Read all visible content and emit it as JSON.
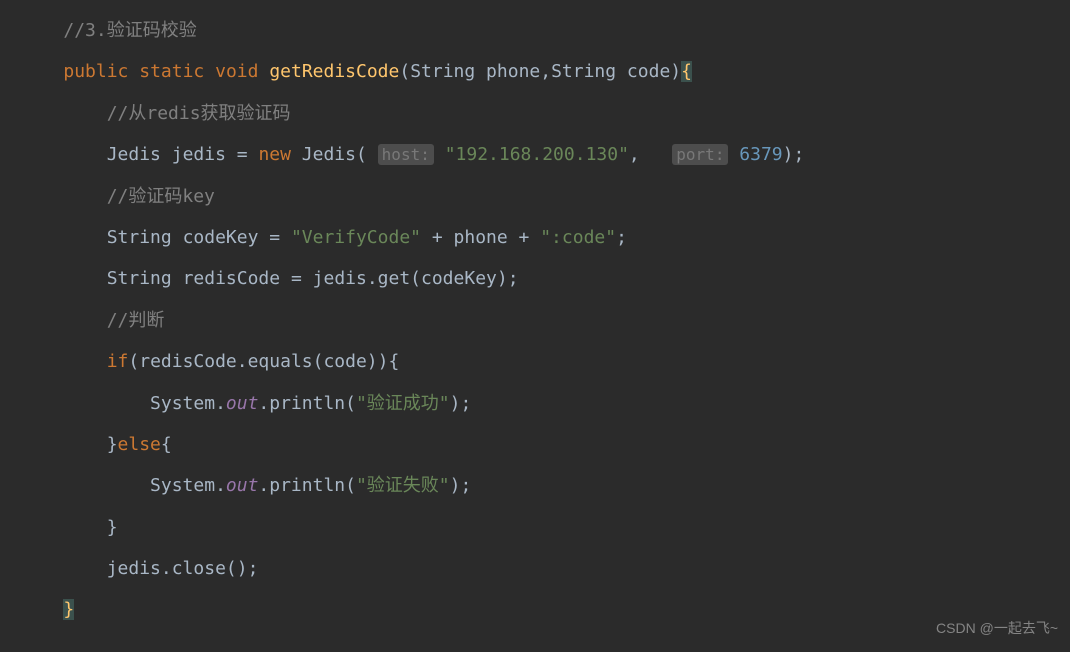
{
  "code": {
    "line1_comment": "//3.验证码校验",
    "line2": {
      "kw_public": "public",
      "kw_static": "static",
      "kw_void": "void",
      "method": "getRedisCode",
      "params": "(String phone,String code)",
      "brace": "{"
    },
    "line3_comment": "//从redis获取验证码",
    "line4": {
      "type": "Jedis",
      "var": "jedis",
      "eq": " = ",
      "kw_new": "new",
      "ctor": "Jedis",
      "host_hint": "host:",
      "host_val": "\"192.168.200.130\"",
      "comma": ",   ",
      "port_hint": "port:",
      "port_val": "6379",
      "end": ");"
    },
    "line5_comment": "//验证码key",
    "line6": {
      "type": "String",
      "var": "codeKey",
      "eq": " = ",
      "str1": "\"VerifyCode\"",
      "plus1": " + ",
      "var2": "phone",
      "plus2": " + ",
      "str2": "\":code\"",
      "semi": ";"
    },
    "line7": {
      "type": "String",
      "var": "redisCode",
      "eq": " = ",
      "expr": "jedis.get(codeKey);"
    },
    "line8_comment": "//判断",
    "line9": {
      "kw_if": "if",
      "cond": "(redisCode.equals(code)){"
    },
    "line10": {
      "sys": "System.",
      "out": "out",
      "println": ".println(",
      "str": "\"验证成功\"",
      "end": ");"
    },
    "line11": {
      "close": "}",
      "kw_else": "else",
      "open": "{"
    },
    "line12": {
      "sys": "System.",
      "out": "out",
      "println": ".println(",
      "str": "\"验证失败\"",
      "end": ");"
    },
    "line13": "}",
    "line14": "jedis.close();",
    "line15": "}"
  },
  "watermark": "CSDN @一起去飞~"
}
